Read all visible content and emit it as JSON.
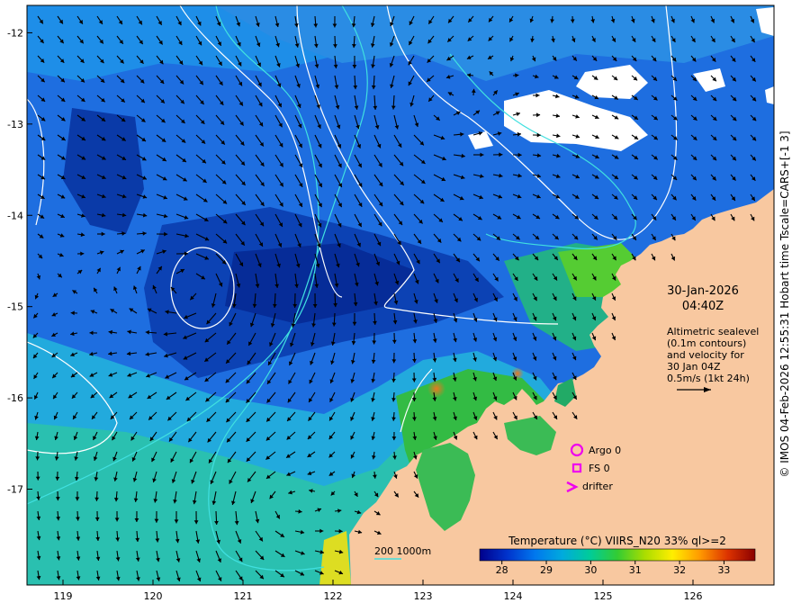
{
  "map": {
    "lon_ticks": [
      "119",
      "120",
      "121",
      "122",
      "123",
      "124",
      "125",
      "126"
    ],
    "lat_ticks": [
      "-12",
      "-13",
      "-14",
      "-15",
      "-16",
      "-17"
    ],
    "lon_range": [
      118.6,
      126.9
    ],
    "lat_range": [
      -18.05,
      -11.7
    ],
    "land_color": "#f8c8a0",
    "cloud_color": "#ffffff"
  },
  "info": {
    "date": "30-Jan-2026",
    "time": "04:40Z",
    "desc_lines": [
      "Altimetric sealevel",
      "(0.1m contours)",
      "and velocity for",
      "30 Jan 04Z",
      "0.5m/s (1kt 24h)"
    ]
  },
  "legend": {
    "argo": "Argo 0",
    "fs": "FS 0",
    "drifter": "drifter",
    "argo_color": "#ee00ee",
    "fs_color": "#ee00ee",
    "drifter_color": "#ee00ee"
  },
  "bathy": {
    "label": "200  1000m",
    "color_200": "#40e0e0",
    "color_1000": "#ffffff"
  },
  "colorbar": {
    "title": "Temperature (°C) VIIRS_N20 33% ql>=2",
    "ticks": [
      "28",
      "29",
      "30",
      "31",
      "32",
      "33"
    ],
    "range": [
      27.5,
      33.7
    ],
    "stops": [
      "#00008b",
      "#0033cc",
      "#0077ee",
      "#00aadd",
      "#00cc99",
      "#33cc33",
      "#aadd00",
      "#ffee00",
      "#ff9900",
      "#dd3300",
      "#8b0000"
    ]
  },
  "credit": "© IMOS 04-Feb-2026 12:55:31 Hobart time Tscale=CARS+[-1 3]"
}
